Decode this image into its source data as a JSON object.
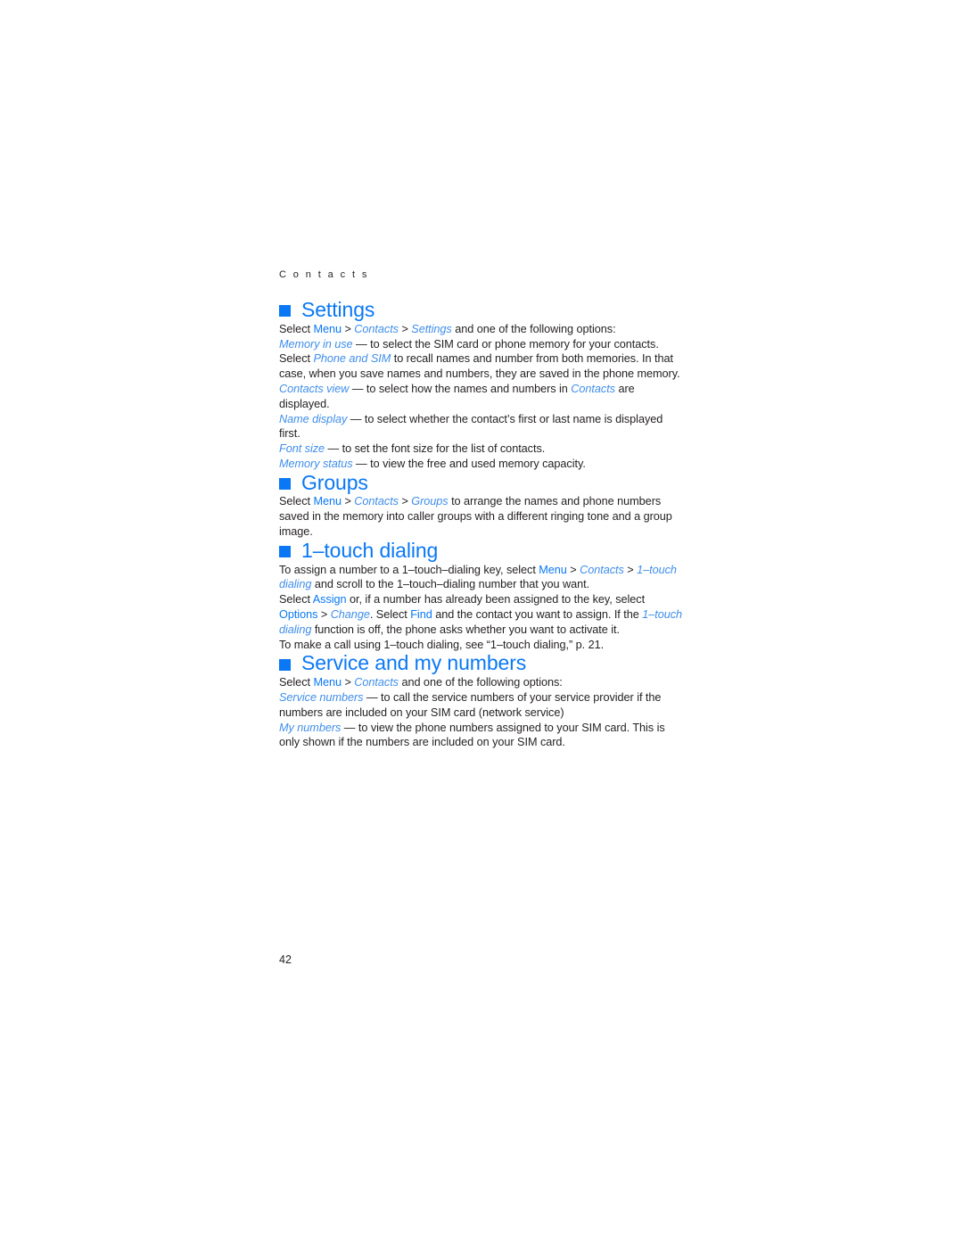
{
  "document": {
    "running_head": "C o n t a c t s",
    "page_number": "42",
    "accent_color": "#0a78f5",
    "link_color": "#3f8eea",
    "text_color": "#231f20"
  },
  "sections": {
    "settings": {
      "heading": "Settings",
      "bullet": "filled-square-bullet",
      "intro": {
        "lead": "Select ",
        "menu": "Menu",
        "sep1": " > ",
        "contacts": "Contacts",
        "sep2": " > ",
        "settings": "Settings",
        "tail": " and one of the following options:"
      },
      "options": [
        {
          "term": "Memory in use",
          "body_a": " — to select the SIM card or phone memory for your contacts. Select ",
          "term2": "Phone and SIM",
          "body_b": " to recall names and number from both memories. In that case, when you save names and numbers, they are saved in the phone memory."
        },
        {
          "term": "Contacts view",
          "body_a": " — to select how the names and numbers in ",
          "term2": "Contacts",
          "body_b": " are displayed."
        },
        {
          "term": "Name display",
          "body_a": " — to select whether the contact’s first or last name is displayed first.",
          "term2": "",
          "body_b": ""
        },
        {
          "term": "Font size",
          "body_a": " — to set the font size for the list of contacts.",
          "term2": "",
          "body_b": ""
        },
        {
          "term": "Memory status",
          "body_a": " — to view the free and used memory capacity.",
          "term2": "",
          "body_b": ""
        }
      ]
    },
    "groups": {
      "heading": "Groups",
      "bullet": "filled-square-bullet",
      "intro": {
        "lead": "Select ",
        "menu": "Menu",
        "sep1": " > ",
        "contacts": "Contacts",
        "sep2": " > ",
        "groups": "Groups",
        "tail": " to arrange the names and phone numbers saved in the memory into caller groups with a different ringing tone and a group image."
      }
    },
    "one_touch": {
      "heading": "1–touch dialing",
      "bullet": "filled-square-bullet",
      "para1": {
        "lead": "To assign a number to a 1–touch–dialing key, select ",
        "menu": "Menu",
        "sep1": " > ",
        "contacts": "Contacts",
        "sep2": " > ",
        "onetouch": "1–touch dialing",
        "tail": " and scroll to the 1–touch–dialing number that you want."
      },
      "para2": {
        "lead": "Select ",
        "assign": "Assign",
        "mid1": " or, if a number has already been assigned to the key, select ",
        "options": "Options",
        "mid2": " > ",
        "change": "Change",
        "mid3": ". Select ",
        "find": "Find",
        "mid4": " and the contact you want to assign. If the ",
        "onetouch": "1–touch dialing",
        "tail": " function is off, the phone asks whether you want to activate it."
      },
      "para3": "To make a call using 1–touch dialing, see “1–touch dialing,” p. 21."
    },
    "service": {
      "heading": "Service and my numbers",
      "bullet": "filled-square-bullet",
      "intro": {
        "lead": "Select ",
        "menu": "Menu",
        "sep1": " > ",
        "contacts": "Contacts",
        "tail": " and one of the following options:"
      },
      "options": [
        {
          "term": "Service numbers",
          "body_a": " — to call the service numbers of your service provider if the numbers are included on your SIM card (network service)"
        },
        {
          "term": "My numbers",
          "body_a": " — to view the phone numbers assigned to your SIM card. This is only shown if the numbers are included on your SIM card."
        }
      ]
    }
  }
}
